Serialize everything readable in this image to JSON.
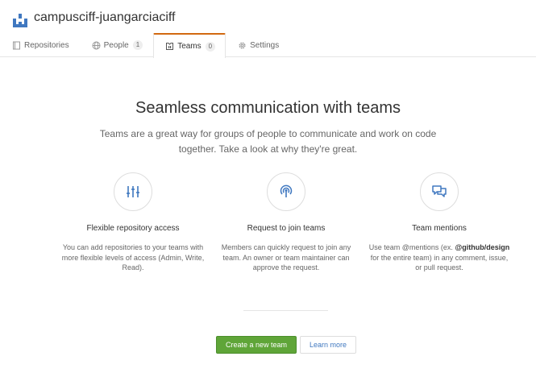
{
  "org": {
    "name": "campusciff-juangarciaciff",
    "logo_icon": "organization-logo-icon"
  },
  "tabs": [
    {
      "label": "Repositories",
      "icon": "repo-icon"
    },
    {
      "label": "People",
      "icon": "globe-icon",
      "count": "1"
    },
    {
      "label": "Teams",
      "icon": "jersey-icon",
      "count": "0",
      "active": true
    },
    {
      "label": "Settings",
      "icon": "gear-icon"
    }
  ],
  "main": {
    "title": "Seamless communication with teams",
    "lead": "Teams are a great way for groups of people to communicate and work on code together. Take a look at why they're great."
  },
  "features": [
    {
      "icon": "settings-sliders-icon",
      "title": "Flexible repository access",
      "description": "You can add repositories to your teams with more flexible levels of access (Admin, Write, Read)."
    },
    {
      "icon": "broadcast-icon",
      "title": "Request to join teams",
      "description": "Members can quickly request to join any team. An owner or team maintainer can approve the request."
    },
    {
      "icon": "comment-discussion-icon",
      "title": "Team mentions",
      "description_before": "Use team @mentions (ex.",
      "description_bold": "@github/design",
      "description_after": "for the entire team) in any comment, issue, or pull request."
    }
  ],
  "actions": {
    "create_label": "Create a new team",
    "learn_label": "Learn more"
  },
  "colors": {
    "active_tab_accent": "#d26911",
    "primary_button": "#5fa538",
    "link": "#4078c0",
    "icon_blue": "#4078c0"
  }
}
